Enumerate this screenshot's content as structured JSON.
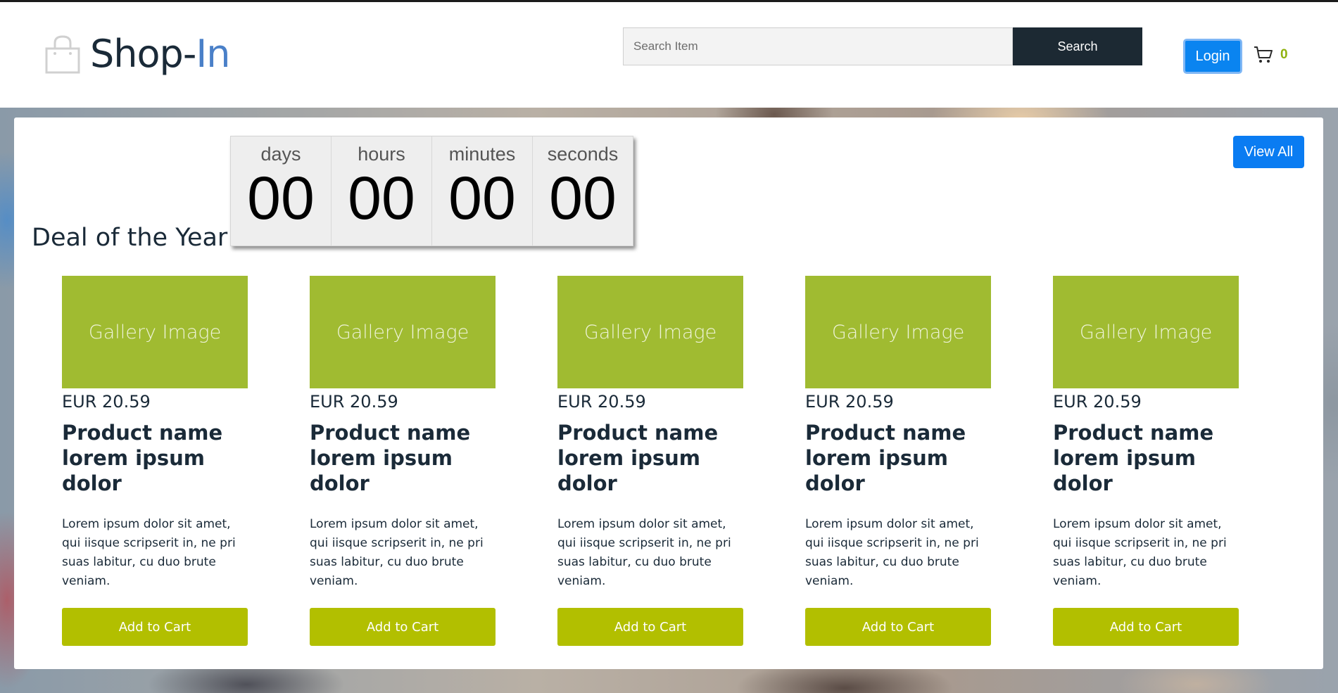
{
  "brand": {
    "name_prefix": "Shop-",
    "name_suffix": "In",
    "accent_color": "#4a80c8",
    "icon": "shopping-bag-icon"
  },
  "search": {
    "placeholder": "Search Item",
    "value": "",
    "button_label": "Search"
  },
  "header": {
    "login_label": "Login",
    "cart_count": "0",
    "cart_icon": "cart-icon"
  },
  "deal": {
    "title": "Deal of the Year",
    "view_all_label": "View All",
    "countdown": [
      {
        "label": "days",
        "value": "00"
      },
      {
        "label": "hours",
        "value": "00"
      },
      {
        "label": "minutes",
        "value": "00"
      },
      {
        "label": "seconds",
        "value": "00"
      }
    ]
  },
  "products": [
    {
      "image_label": "Gallery Image",
      "price": "EUR 20.59",
      "name": "Product name lorem ipsum dolor",
      "description": "Lorem ipsum dolor sit amet, qui iisque scripserit in, ne pri suas labitur, cu duo brute veniam.",
      "button_label": "Add to Cart"
    },
    {
      "image_label": "Gallery Image",
      "price": "EUR 20.59",
      "name": "Product name lorem ipsum dolor",
      "description": "Lorem ipsum dolor sit amet, qui iisque scripserit in, ne pri suas labitur, cu duo brute veniam.",
      "button_label": "Add to Cart"
    },
    {
      "image_label": "Gallery Image",
      "price": "EUR 20.59",
      "name": "Product name lorem ipsum dolor",
      "description": "Lorem ipsum dolor sit amet, qui iisque scripserit in, ne pri suas labitur, cu duo brute veniam.",
      "button_label": "Add to Cart"
    },
    {
      "image_label": "Gallery Image",
      "price": "EUR 20.59",
      "name": "Product name lorem ipsum dolor",
      "description": "Lorem ipsum dolor sit amet, qui iisque scripserit in, ne pri suas labitur, cu duo brute veniam.",
      "button_label": "Add to Cart"
    },
    {
      "image_label": "Gallery Image",
      "price": "EUR 20.59",
      "name": "Product name lorem ipsum dolor",
      "description": "Lorem ipsum dolor sit amet, qui iisque scripserit in, ne pri suas labitur, cu duo brute veniam.",
      "button_label": "Add to Cart"
    }
  ],
  "colors": {
    "image_placeholder": "#a0bb31",
    "add_to_cart": "#b2bf00",
    "primary_button": "#0a84f0",
    "search_button": "#1c2933"
  }
}
